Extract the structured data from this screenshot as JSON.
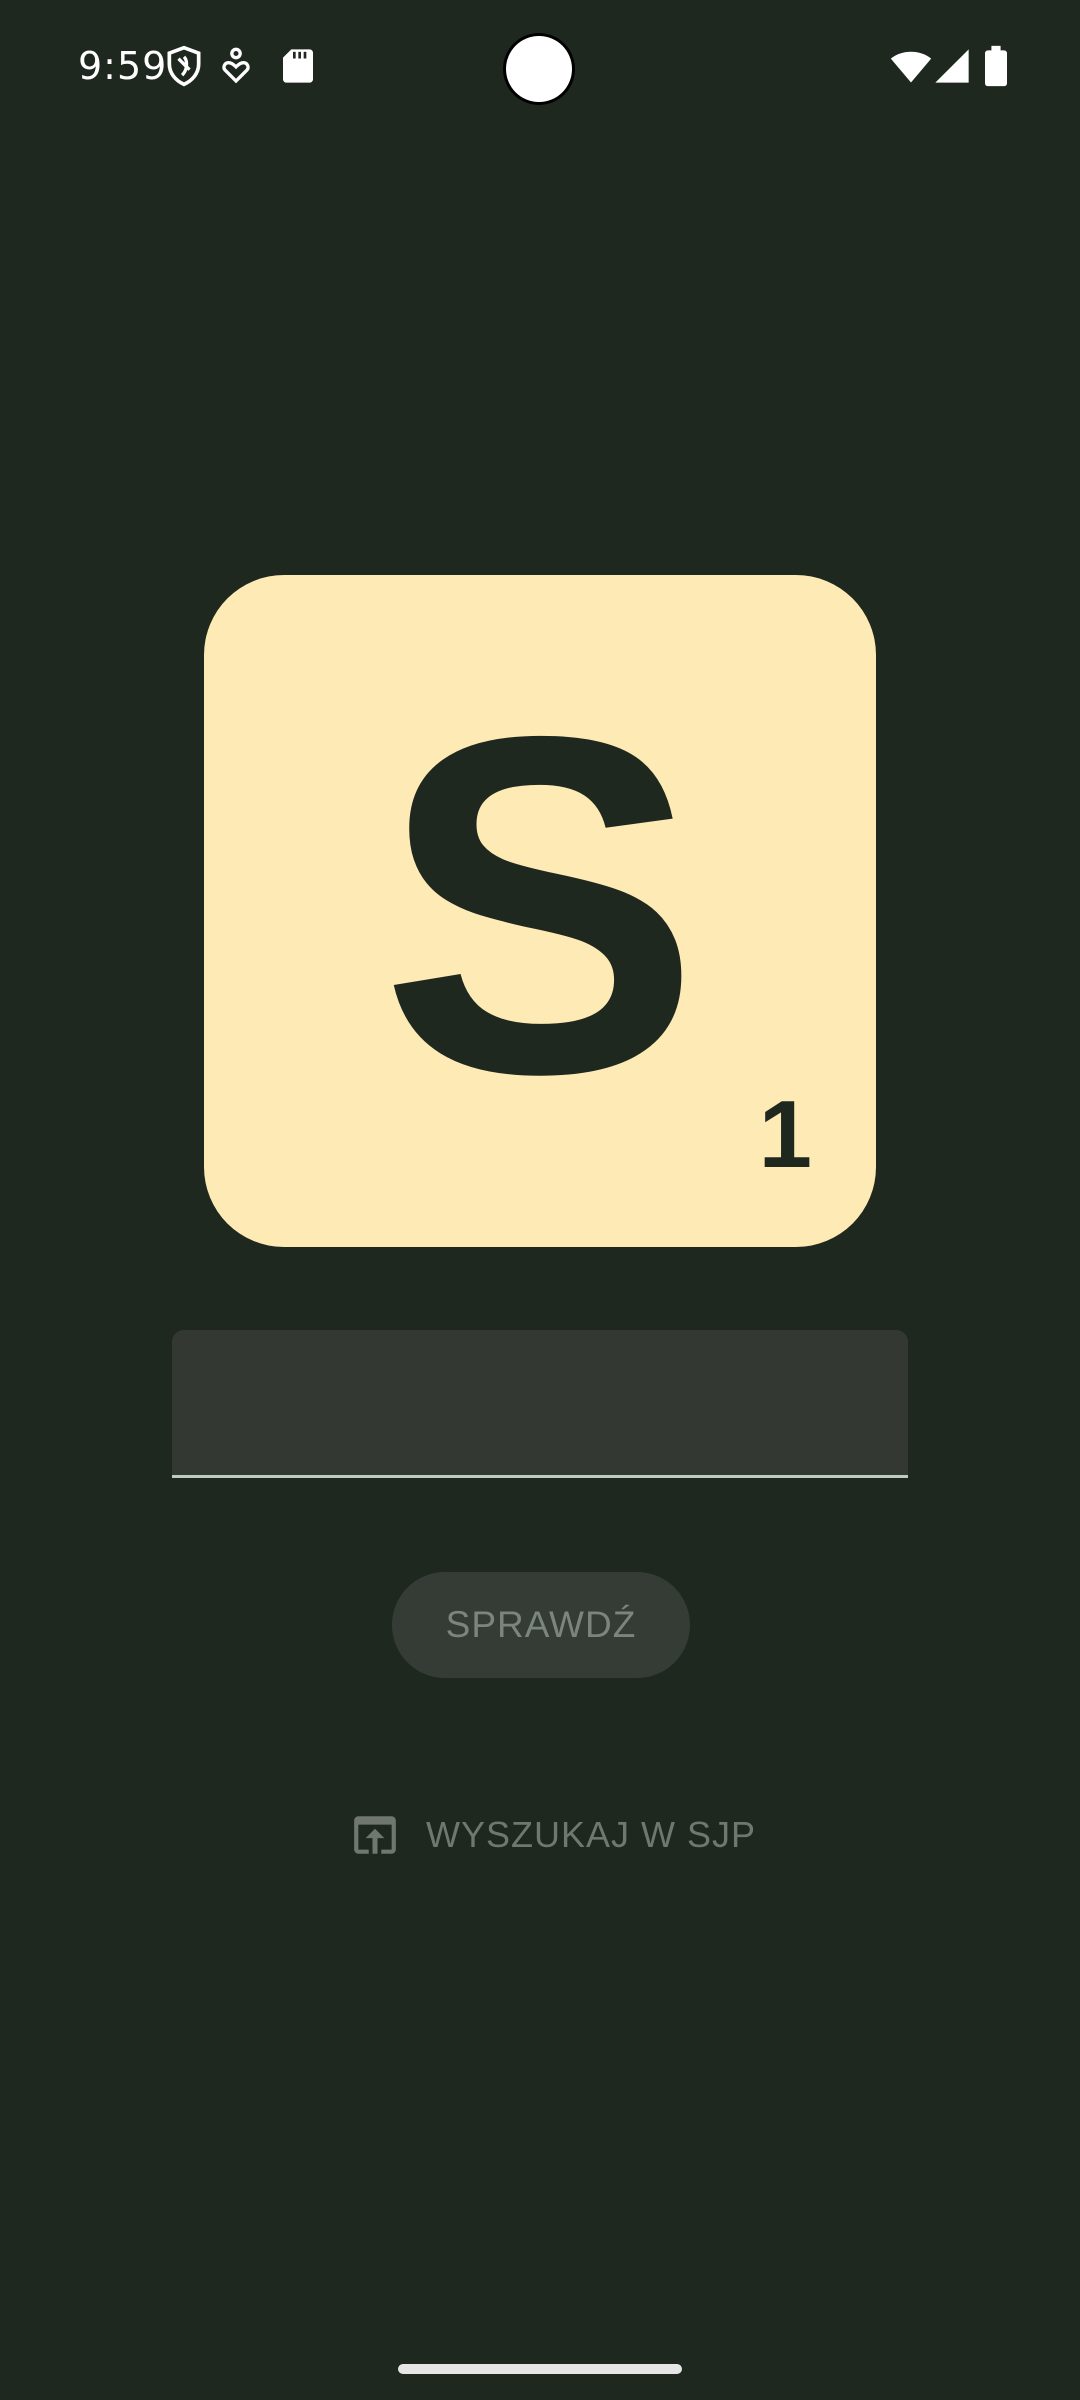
{
  "status_bar": {
    "time": "9:59",
    "icons": [
      "shield-icon",
      "accessibility-icon",
      "sd-card-icon",
      "wifi-icon",
      "signal-icon",
      "battery-icon"
    ]
  },
  "tile": {
    "letter": "S",
    "score": "1"
  },
  "word_input": {
    "value": "",
    "placeholder": ""
  },
  "check_button": {
    "label": "SPRAWDŹ"
  },
  "sjp_link": {
    "label": "WYSZUKAJ W SJP",
    "icon": "open-in-icon"
  },
  "colors": {
    "background": "#1f281f",
    "tile": "#fdeab5",
    "tile_text": "#1f281f",
    "input_bg": "#333832",
    "button_bg": "#353c35",
    "button_text": "#7c857c",
    "link_text": "#6f776f"
  }
}
